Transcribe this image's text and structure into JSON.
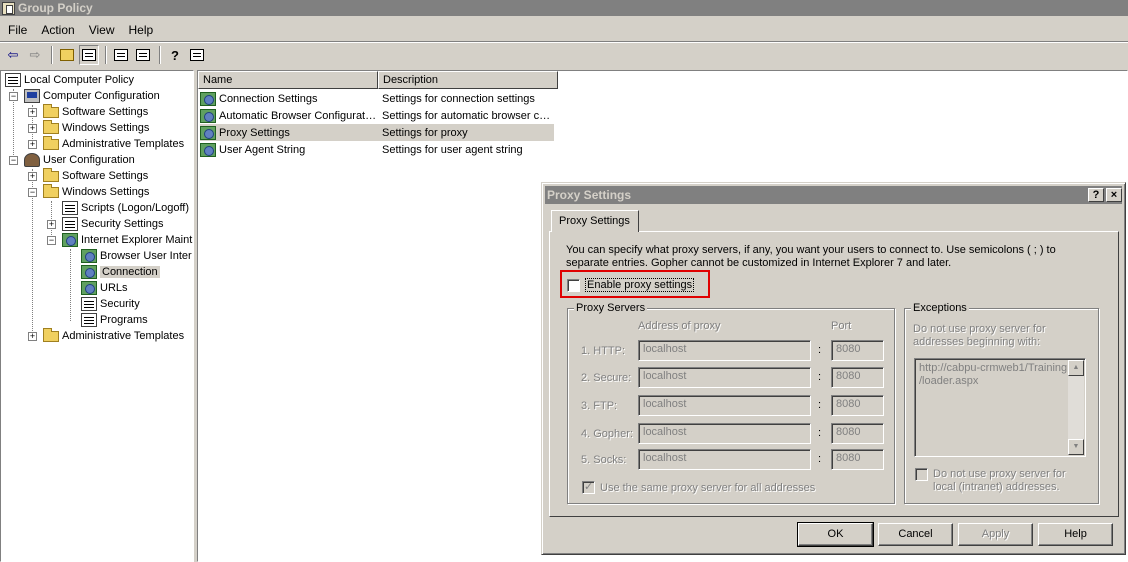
{
  "window": {
    "title": "Group Policy"
  },
  "menu": [
    "File",
    "Action",
    "View",
    "Help"
  ],
  "toolbar": {
    "icons": [
      "back-arrow-icon",
      "forward-arrow-icon",
      "up-folder-icon",
      "show-hide-tree-icon",
      "properties-icon",
      "export-list-icon",
      "help-icon",
      "show-hide-action-pane-icon"
    ]
  },
  "tree": {
    "root": "Local Computer Policy",
    "computer_config": "Computer Configuration",
    "cc_software": "Software Settings",
    "cc_windows": "Windows Settings",
    "cc_admin": "Administrative Templates",
    "user_config": "User Configuration",
    "uc_software": "Software Settings",
    "uc_windows": "Windows Settings",
    "scripts": "Scripts (Logon/Logoff)",
    "security_settings": "Security Settings",
    "ie_maint": "Internet Explorer Maint",
    "browser_ui": "Browser User Inter",
    "connection": "Connection",
    "urls": "URLs",
    "security": "Security",
    "programs": "Programs",
    "uc_admin": "Administrative Templates"
  },
  "list": {
    "columns": [
      "Name",
      "Description"
    ],
    "rows": [
      {
        "name": "Connection Settings",
        "description": "Settings for connection settings"
      },
      {
        "name": "Automatic Browser Configurat…",
        "description": "Settings for automatic browser c…"
      },
      {
        "name": "Proxy Settings",
        "description": "Settings for proxy"
      },
      {
        "name": "User Agent String",
        "description": "Settings for user agent string"
      }
    ]
  },
  "dialog": {
    "title": "Proxy Settings",
    "help_btn": "?",
    "close_btn": "×",
    "tab": "Proxy Settings",
    "intro": "You can specify what proxy servers, if any, you want your users to connect to. Use semicolons ( ; ) to separate entries. Gopher cannot be customized in Internet Explorer 7 and later.",
    "enable_label": "Enable proxy settings",
    "enable_checked": false,
    "proxy_servers": {
      "title": "Proxy Servers",
      "address_header": "Address of proxy",
      "port_header": "Port",
      "rows": [
        {
          "num": "1.",
          "label": "HTTP:",
          "address": "localhost",
          "port": "8080"
        },
        {
          "num": "2.",
          "label": "Secure:",
          "address": "localhost",
          "port": "8080"
        },
        {
          "num": "3.",
          "label": "FTP:",
          "address": "localhost",
          "port": "8080"
        },
        {
          "num": "4.",
          "label": "Gopher:",
          "address": "localhost",
          "port": "8080"
        },
        {
          "num": "5.",
          "label": "Socks:",
          "address": "localhost",
          "port": "8080"
        }
      ],
      "colon": ":",
      "same_proxy_label": "Use the same proxy server for all addresses",
      "same_proxy_checked": true
    },
    "exceptions": {
      "title": "Exceptions",
      "desc_line1": "Do not use proxy server for",
      "desc_line2": "addresses beginning with:",
      "value_line1": "http://cabpu-crmweb1/Training",
      "value_line2": "/loader.aspx",
      "local_label_line1": "Do not use proxy server for",
      "local_label_line2": "local (intranet) addresses.",
      "local_checked": false
    },
    "buttons": {
      "ok": "OK",
      "cancel": "Cancel",
      "apply": "Apply",
      "help": "Help"
    }
  }
}
